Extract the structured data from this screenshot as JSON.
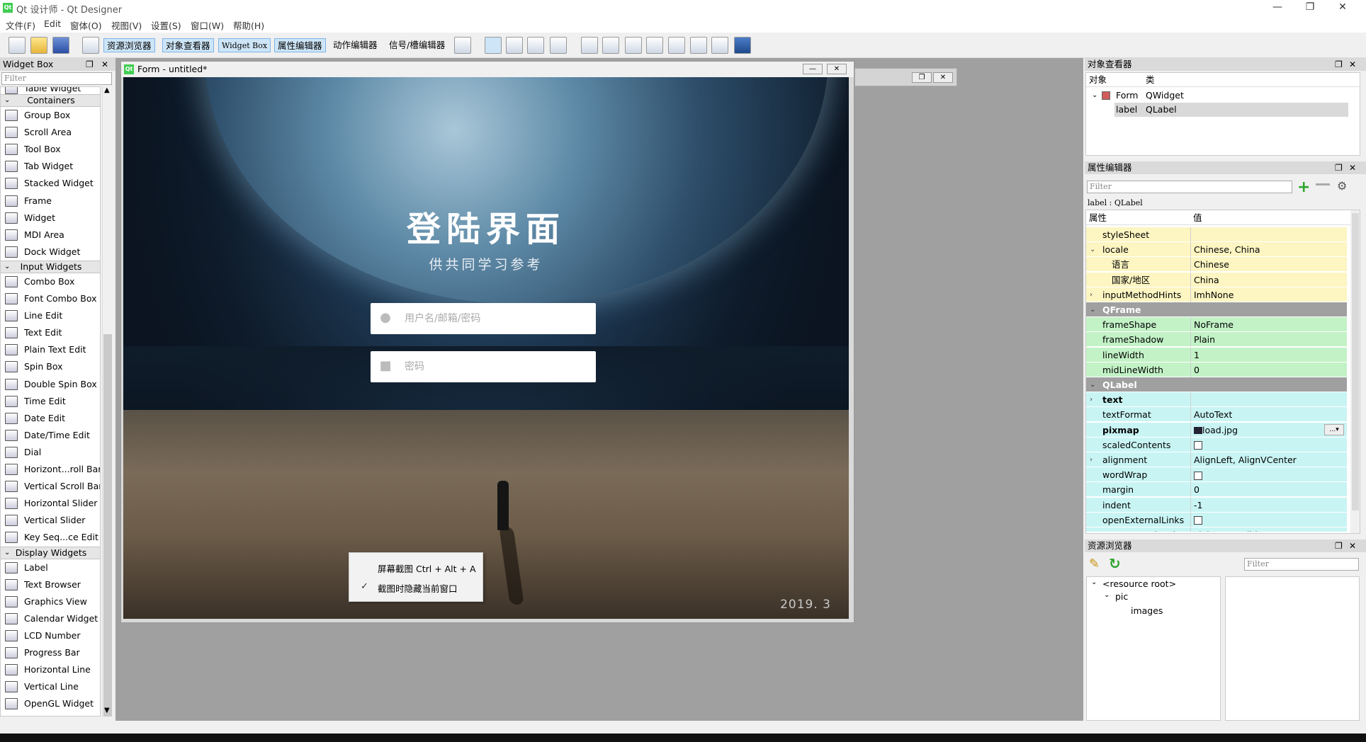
{
  "window": {
    "title": "Qt 设计师 - Qt Designer",
    "logo": "Qt",
    "controls": [
      "—",
      "❐",
      "✕"
    ]
  },
  "menu": [
    "文件(F)",
    "Edit",
    "窗体(O)",
    "视图(V)",
    "设置(S)",
    "窗口(W)",
    "帮助(H)"
  ],
  "toolbar": {
    "tabs": [
      "资源浏览器",
      "对象查看器",
      "Widget Box",
      "属性编辑器",
      "动作编辑器",
      "信号/槽编辑器"
    ]
  },
  "widget_box": {
    "title": "Widget Box",
    "filter_placeholder": "Filter",
    "partial_top": "Table Widget",
    "categories": [
      {
        "name": "Containers",
        "items": [
          "Group Box",
          "Scroll Area",
          "Tool Box",
          "Tab Widget",
          "Stacked Widget",
          "Frame",
          "Widget",
          "MDI Area",
          "Dock Widget"
        ]
      },
      {
        "name": "Input Widgets",
        "items": [
          "Combo Box",
          "Font Combo Box",
          "Line Edit",
          "Text Edit",
          "Plain Text Edit",
          "Spin Box",
          "Double Spin Box",
          "Time Edit",
          "Date Edit",
          "Date/Time Edit",
          "Dial",
          "Horizont...roll Bar",
          "Vertical Scroll Bar",
          "Horizontal Slider",
          "Vertical Slider",
          "Key Seq...ce Edit"
        ]
      },
      {
        "name": "Display Widgets",
        "items": [
          "Label",
          "Text Browser",
          "Graphics View",
          "Calendar Widget",
          "LCD Number",
          "Progress Bar",
          "Horizontal Line",
          "Vertical Line",
          "OpenGL Widget"
        ]
      }
    ]
  },
  "form": {
    "title": "Form - untitled*",
    "login_title": "登陆界面",
    "login_subtitle": "供共同学习参考",
    "username_placeholder": "用户名/邮箱/密码",
    "password_placeholder": "密码",
    "year": "2019. 3",
    "context_menu": [
      "屏幕截图 Ctrl + Alt + A",
      "截图时隐藏当前窗口"
    ]
  },
  "object_inspector": {
    "title": "对象查看器",
    "headers": [
      "对象",
      "类"
    ],
    "rows": [
      {
        "object": "Form",
        "class": "QWidget"
      },
      {
        "object": "label",
        "class": "QLabel"
      }
    ]
  },
  "property_editor": {
    "title": "属性编辑器",
    "filter_placeholder": "Filter",
    "object_label": "label : QLabel",
    "headers": [
      "属性",
      "值"
    ],
    "rows": [
      {
        "k": "styleSheet",
        "v": "",
        "c": "y"
      },
      {
        "k": "locale",
        "v": "Chinese, China",
        "c": "y",
        "exp": "⌄"
      },
      {
        "k": "语言",
        "v": "Chinese",
        "c": "y",
        "indent": true
      },
      {
        "k": "国家/地区",
        "v": "China",
        "c": "y",
        "indent": true
      },
      {
        "k": "inputMethodHints",
        "v": "ImhNone",
        "c": "y",
        "exp": "›"
      },
      {
        "k": "QFrame",
        "v": "",
        "c": "sec",
        "exp": "⌄"
      },
      {
        "k": "frameShape",
        "v": "NoFrame",
        "c": "g"
      },
      {
        "k": "frameShadow",
        "v": "Plain",
        "c": "g"
      },
      {
        "k": "lineWidth",
        "v": "1",
        "c": "g"
      },
      {
        "k": "midLineWidth",
        "v": "0",
        "c": "g"
      },
      {
        "k": "QLabel",
        "v": "",
        "c": "sec",
        "exp": "⌄"
      },
      {
        "k": "text",
        "v": "",
        "c": "c",
        "exp": "›",
        "bold": true
      },
      {
        "k": "textFormat",
        "v": "AutoText",
        "c": "c"
      },
      {
        "k": "pixmap",
        "v": "load.jpg",
        "c": "c",
        "bold": true
      },
      {
        "k": "scaledContents",
        "v": "",
        "c": "c",
        "checkbox": true
      },
      {
        "k": "alignment",
        "v": "AlignLeft, AlignVCenter",
        "c": "c",
        "exp": "›"
      },
      {
        "k": "wordWrap",
        "v": "",
        "c": "c",
        "checkbox": true
      },
      {
        "k": "margin",
        "v": "0",
        "c": "c"
      },
      {
        "k": "indent",
        "v": "-1",
        "c": "c"
      },
      {
        "k": "openExternalLinks",
        "v": "",
        "c": "c",
        "checkbox": true
      },
      {
        "k": "textInteractionFlags",
        "v": "LinksAccessibleByMouse",
        "c": "c"
      }
    ]
  },
  "resource_browser": {
    "title": "资源浏览器",
    "filter_placeholder": "Filter",
    "tree": [
      "<resource root>",
      "pic",
      "images"
    ]
  }
}
